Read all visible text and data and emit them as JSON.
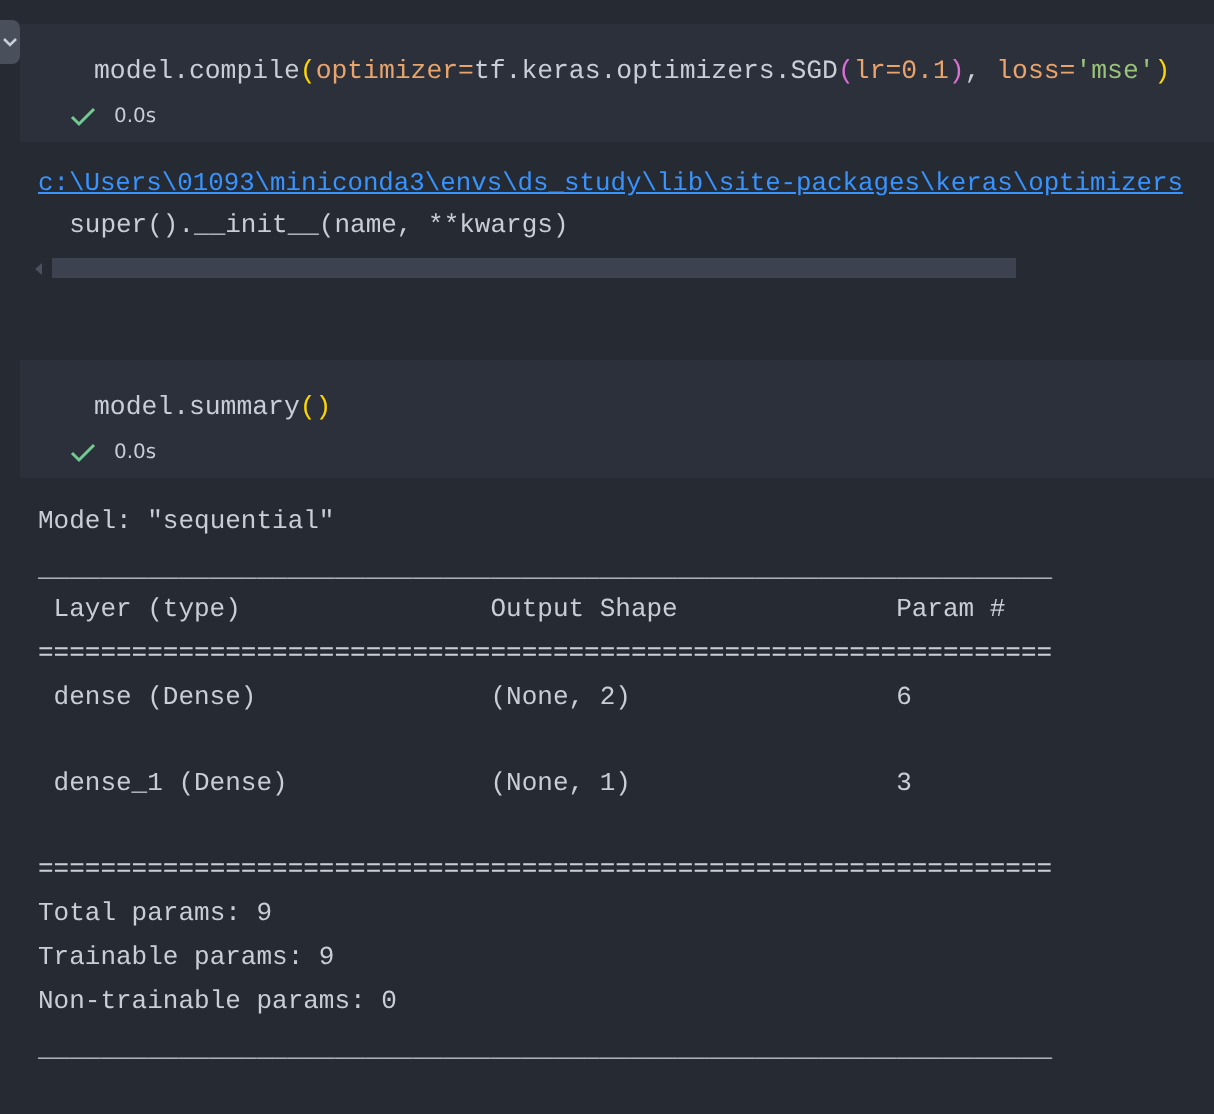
{
  "cells": [
    {
      "collapse_button": true,
      "code": [
        {
          "text": "model.compile",
          "kind": "plain"
        },
        {
          "text": "(",
          "kind": "bracket"
        },
        {
          "text": "optimizer=",
          "kind": "param"
        },
        {
          "text": "tf.keras.optimizers.SGD",
          "kind": "plain"
        },
        {
          "text": "(",
          "kind": "bracket2"
        },
        {
          "text": "lr=0.1",
          "kind": "param"
        },
        {
          "text": ")",
          "kind": "bracket2"
        },
        {
          "text": ", ",
          "kind": "plain"
        },
        {
          "text": "loss=",
          "kind": "param"
        },
        {
          "text": "'mse'",
          "kind": "string"
        },
        {
          "text": ")",
          "kind": "bracket"
        }
      ],
      "status": {
        "success": true,
        "time": "0.0s"
      },
      "output": {
        "kind": "warning",
        "link": "c:\\Users\\01093\\miniconda3\\envs\\ds_study\\lib\\site-packages\\keras\\optimizers",
        "lines": [
          "  super().__init__(name, **kwargs)"
        ]
      }
    },
    {
      "collapse_button": false,
      "code": [
        {
          "text": "model.summary",
          "kind": "plain"
        },
        {
          "text": "()",
          "kind": "bracket"
        }
      ],
      "status": {
        "success": true,
        "time": "0.0s"
      },
      "output": {
        "kind": "summary",
        "title": "Model: \"sequential\"",
        "rule_top": "_________________________________________________________________",
        "columns": [
          "Layer (type)",
          "Output Shape",
          "Param #"
        ],
        "rule_double": "=================================================================",
        "rows": [
          [
            "dense (Dense)",
            "(None, 2)",
            "6"
          ],
          [
            "dense_1 (Dense)",
            "(None, 1)",
            "3"
          ]
        ],
        "rule_mid": "=================================================================",
        "totals": [
          "Total params: 9",
          "Trainable params: 9",
          "Non-trainable params: 0"
        ],
        "rule_bottom": "_________________________________________________________________"
      }
    }
  ]
}
